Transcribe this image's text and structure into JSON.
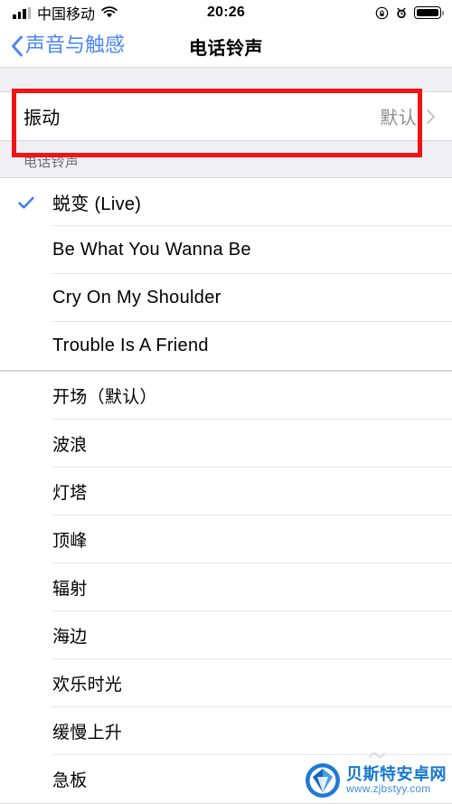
{
  "status_bar": {
    "carrier": "中国移动",
    "time": "20:26",
    "icons": {
      "signal": "signal-bars-icon",
      "wifi": "wifi-icon",
      "rotation_lock": "rotation-lock-icon",
      "alarm": "alarm-clock-icon",
      "battery": "battery-icon"
    }
  },
  "nav": {
    "back_label": "声音与触感",
    "title": "电话铃声"
  },
  "vibration_group": {
    "rows": [
      {
        "label": "振动",
        "value": "默认"
      }
    ]
  },
  "section_header": "电话铃声",
  "ringtones_custom": [
    {
      "label": "蜕变 (Live)",
      "selected": true,
      "cjk": false
    }
  ],
  "ringtones_songs": [
    {
      "label": "Be What You Wanna Be",
      "selected": false,
      "cjk": false
    },
    {
      "label": "Cry On My Shoulder",
      "selected": false,
      "cjk": false
    },
    {
      "label": "Trouble Is A Friend",
      "selected": false,
      "cjk": false
    }
  ],
  "ringtones_system": [
    {
      "label": "开场（默认）",
      "selected": false,
      "cjk": true
    },
    {
      "label": "波浪",
      "selected": false,
      "cjk": true
    },
    {
      "label": "灯塔",
      "selected": false,
      "cjk": true
    },
    {
      "label": "顶峰",
      "selected": false,
      "cjk": true
    },
    {
      "label": "辐射",
      "selected": false,
      "cjk": true
    },
    {
      "label": "海边",
      "selected": false,
      "cjk": true
    },
    {
      "label": "欢乐时光",
      "selected": false,
      "cjk": true
    },
    {
      "label": "缓慢上升",
      "selected": false,
      "cjk": true
    },
    {
      "label": "急板",
      "selected": false,
      "cjk": true
    }
  ],
  "watermark": {
    "title": "贝斯特安卓网",
    "url": "www.zjbstyy.com"
  },
  "colors": {
    "accent_blue": "#3478f6",
    "back_blue": "#4a86f7",
    "highlight_red": "#f01414",
    "group_bg": "#efeff4",
    "secondary_text": "#8e8e93",
    "header_text": "#6d6d72",
    "watermark_blue": "#1477d1"
  }
}
